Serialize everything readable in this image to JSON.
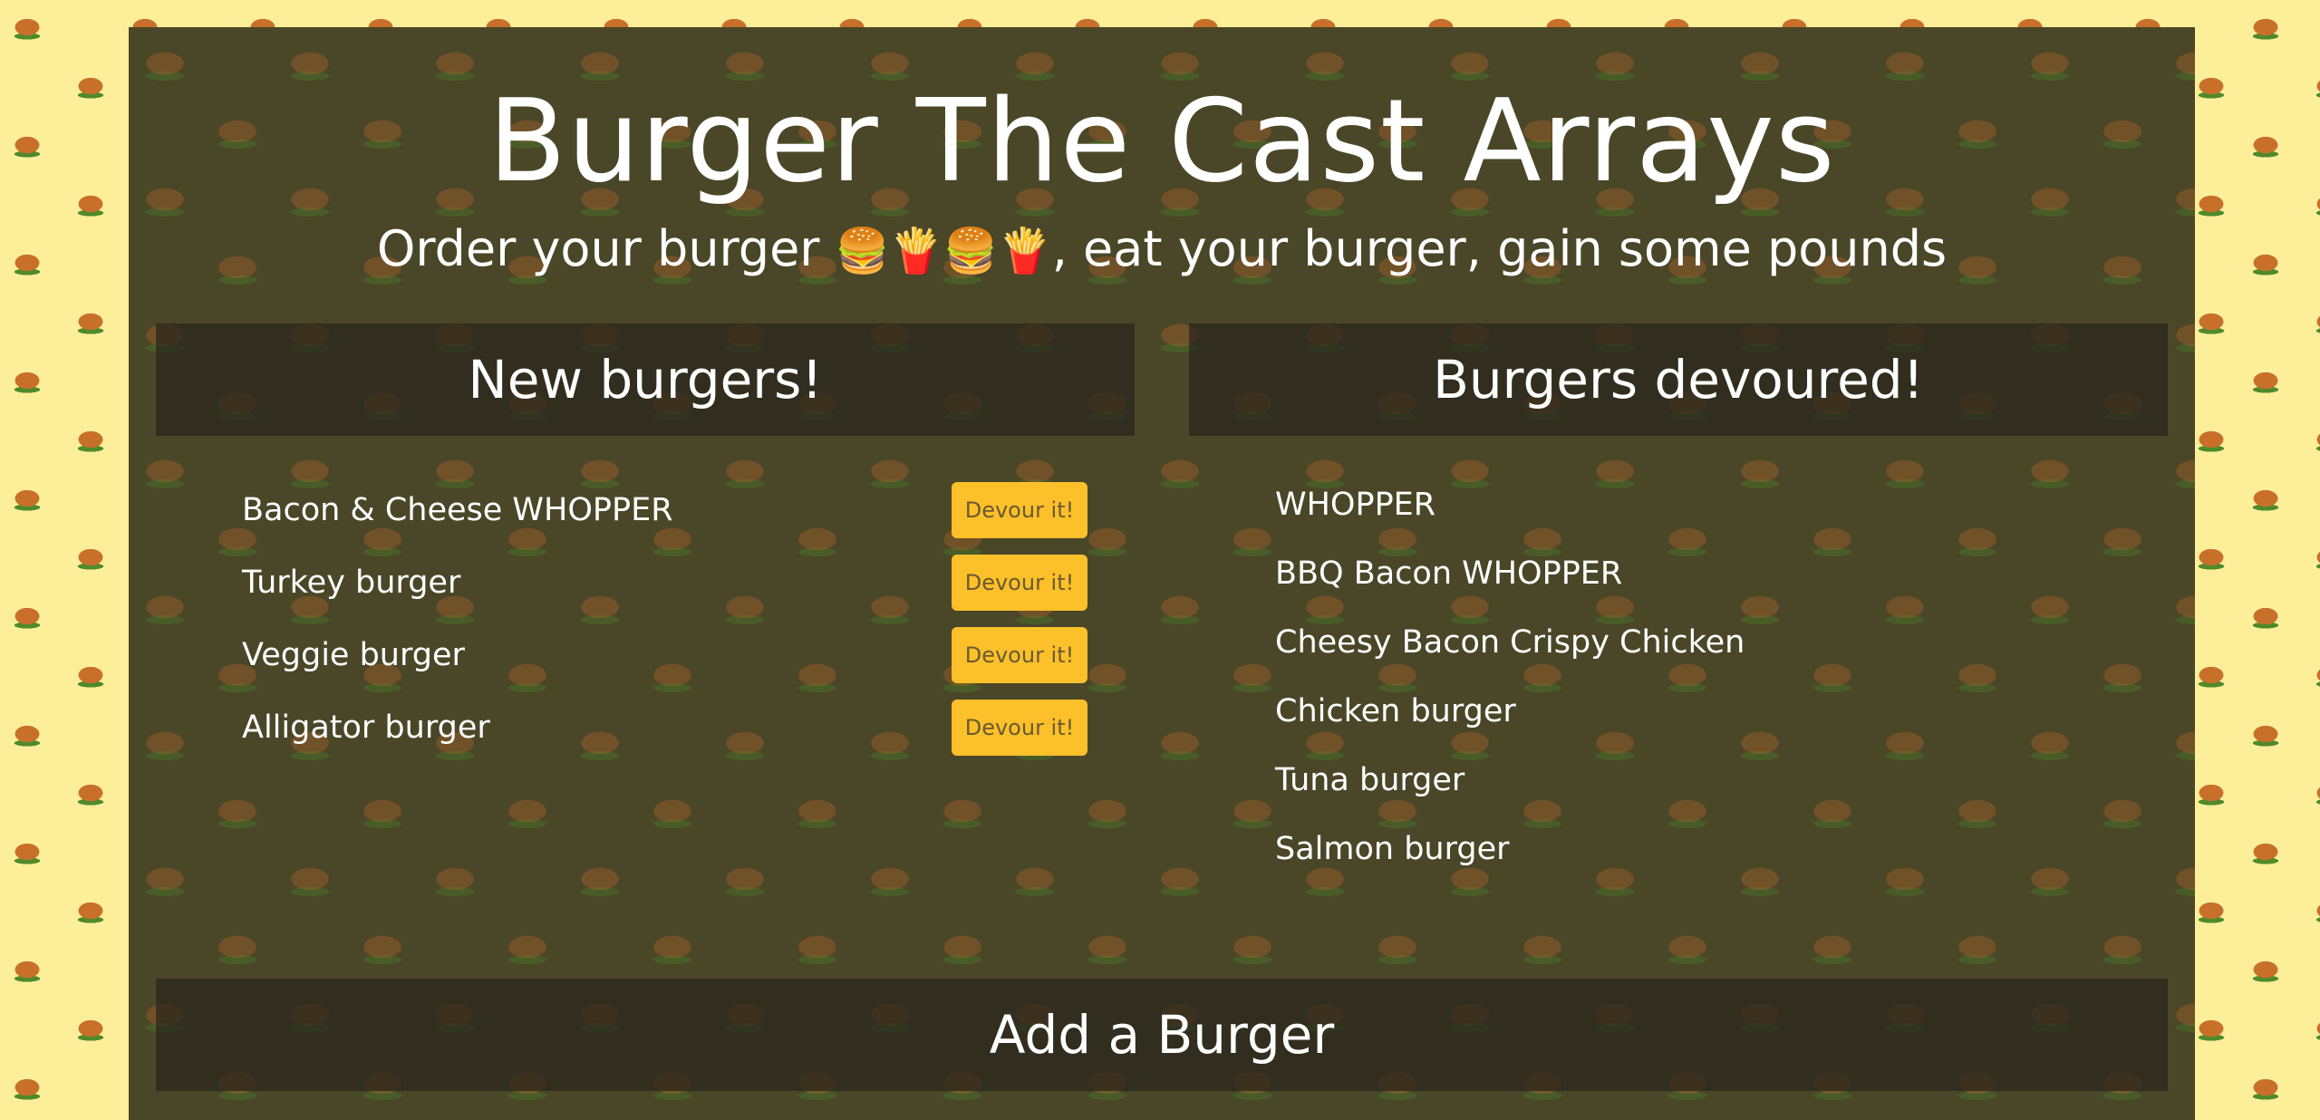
{
  "app": {
    "title": "Burger The Cast Arrays",
    "subtitle_before": "Order your burger ",
    "subtitle_emoji": "🍔🍟🍔🍟",
    "subtitle_after": ", eat your burger, gain some pounds"
  },
  "new_burgers": {
    "header": "New burgers!",
    "items": [
      {
        "name": "Bacon & Cheese WHOPPER",
        "button": "Devour it!"
      },
      {
        "name": "Turkey burger",
        "button": "Devour it!"
      },
      {
        "name": "Veggie burger",
        "button": "Devour it!"
      },
      {
        "name": "Alligator burger",
        "button": "Devour it!"
      }
    ]
  },
  "devoured": {
    "header": "Burgers devoured!",
    "items": [
      "WHOPPER",
      "BBQ Bacon WHOPPER",
      "Cheesy Bacon Crispy Chicken",
      "Chicken burger",
      "Tuna burger",
      "Salmon burger"
    ]
  },
  "add_section": {
    "header": "Add a Burger"
  },
  "colors": {
    "background": "#fdee9a",
    "panel": "#4a4628",
    "button": "#fcc02a",
    "button_text": "#6a5a30",
    "text": "#ffffff"
  }
}
